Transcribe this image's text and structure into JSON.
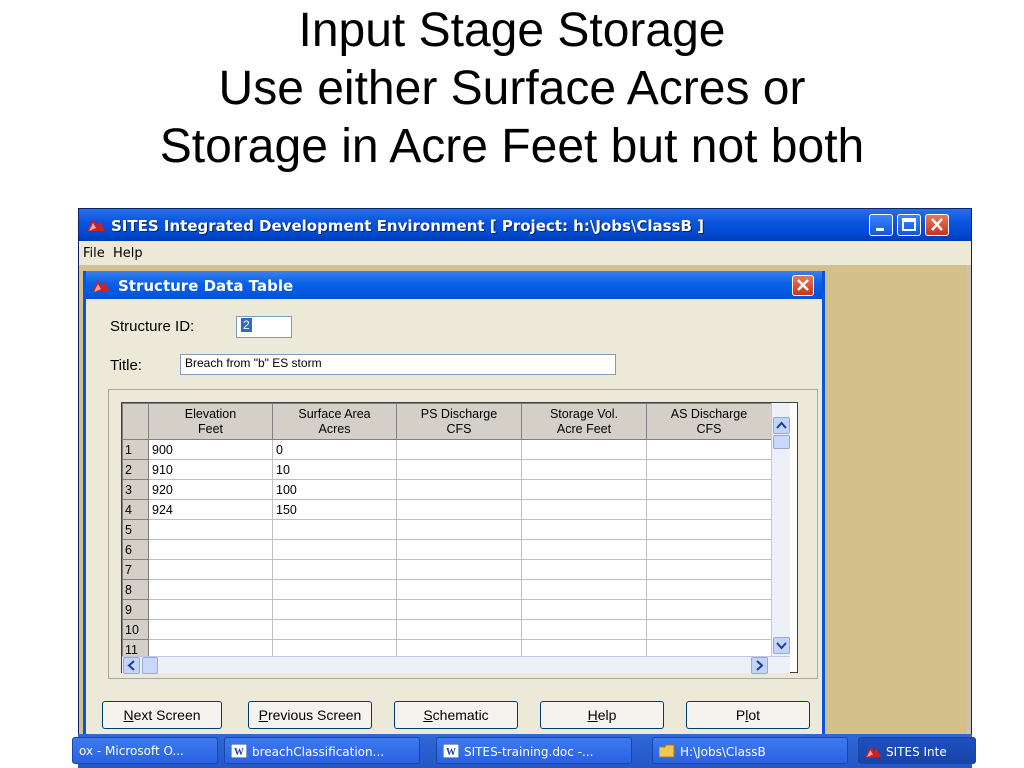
{
  "slide": {
    "title_lines": [
      "Input Stage Storage",
      "Use either Surface Acres or",
      "Storage in Acre Feet but not both"
    ]
  },
  "app": {
    "title": "SITES Integrated Development Environment [ Project: h:\\Jobs\\ClassB ]",
    "menu": {
      "file": "File",
      "help": "Help"
    }
  },
  "dialog": {
    "title": "Structure Data Table",
    "structure_id_label": "Structure ID:",
    "structure_id_value": "2",
    "title_label": "Title:",
    "title_value": "Breach from \"b\" ES storm",
    "columns": [
      {
        "line1": "Elevation",
        "line2": "Feet"
      },
      {
        "line1": "Surface Area",
        "line2": "Acres"
      },
      {
        "line1": "PS Discharge",
        "line2": "CFS"
      },
      {
        "line1": "Storage Vol.",
        "line2": "Acre Feet"
      },
      {
        "line1": "AS Discharge",
        "line2": "CFS"
      }
    ],
    "rows": [
      {
        "n": "1",
        "elev": "900",
        "area": "0"
      },
      {
        "n": "2",
        "elev": "910",
        "area": "10"
      },
      {
        "n": "3",
        "elev": "920",
        "area": "100"
      },
      {
        "n": "4",
        "elev": "924",
        "area": "150"
      },
      {
        "n": "5",
        "elev": "",
        "area": ""
      },
      {
        "n": "6",
        "elev": "",
        "area": ""
      },
      {
        "n": "7",
        "elev": "",
        "area": ""
      },
      {
        "n": "8",
        "elev": "",
        "area": ""
      },
      {
        "n": "9",
        "elev": "",
        "area": ""
      },
      {
        "n": "10",
        "elev": "",
        "area": ""
      },
      {
        "n": "11",
        "elev": "",
        "area": ""
      }
    ],
    "buttons": {
      "next": {
        "accel": "N",
        "rest": "ext Screen"
      },
      "previous": {
        "accel": "P",
        "rest": "revious Screen"
      },
      "schematic": {
        "accel": "S",
        "rest": "chematic"
      },
      "help": {
        "accel": "H",
        "rest": "elp"
      },
      "plot": {
        "pre": "P",
        "accel": "l",
        "rest": "ot"
      }
    }
  },
  "taskbar": {
    "items": [
      "ox - Microsoft O...",
      "breachClassification...",
      "SITES-training.doc -...",
      "H:\\Jobs\\ClassB",
      "SITES Inte"
    ]
  },
  "colors": {
    "xp_blue": "#0a55e0",
    "close_red": "#c8351a",
    "client_tan": "#d4c08a"
  }
}
